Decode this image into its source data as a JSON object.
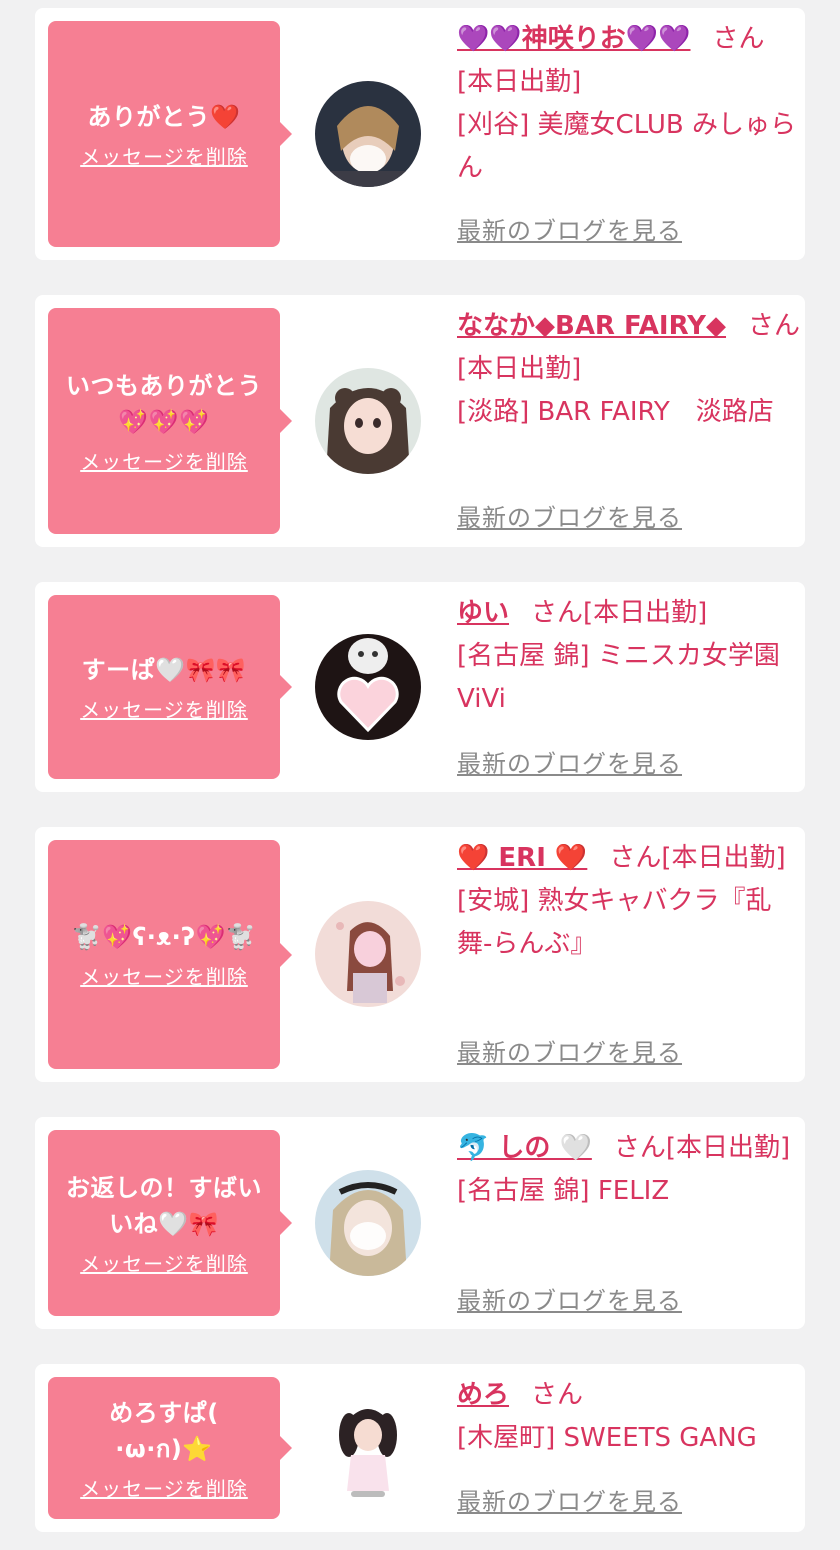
{
  "cards": [
    {
      "message": "ありがとう❤️",
      "delete_label": "メッセージを削除",
      "name": "💜💜神咲りお💜💜",
      "honorific": "さん",
      "status": "[本日出勤]",
      "shop": "[刈谷] 美魔女CLUB みしゅらん",
      "blog_label": "最新のブログを見る"
    },
    {
      "message": "いつもありがとう💖💖💖",
      "delete_label": "メッセージを削除",
      "name": "ななか◆BAR FAIRY◆",
      "honorific": "さん",
      "status": "[本日出勤]",
      "shop": "[淡路] BAR FAIRY　淡路店",
      "blog_label": "最新のブログを見る"
    },
    {
      "message": "すーぱ🤍🎀🎀",
      "delete_label": "メッセージを削除",
      "name": "ゆい",
      "honorific": "さん",
      "status": "[本日出勤]",
      "shop": "[名古屋 錦] ミニスカ女学園ViVi",
      "blog_label": "最新のブログを見る"
    },
    {
      "message": "🐩💖ʕ·ᴥ·ʔ💖🐩",
      "delete_label": "メッセージを削除",
      "name": "❤️ ERI ❤️",
      "honorific": "さん",
      "status": "[本日出勤]",
      "shop": "[安城] 熟女キャバクラ『乱舞-らんぶ』",
      "blog_label": "最新のブログを見る"
    },
    {
      "message": "お返しの！すばいいね🤍🎀",
      "delete_label": "メッセージを削除",
      "name": "🐬 しの 🤍",
      "honorific": "さん",
      "status": "[本日出勤]",
      "shop": "[名古屋 錦] FELIZ",
      "blog_label": "最新のブログを見る"
    },
    {
      "message": "めろすぱ( ·ω·ก)⭐",
      "delete_label": "メッセージを削除",
      "name": "めろ",
      "honorific": "さん",
      "status": "",
      "shop": "[木屋町] SWEETS GANG",
      "blog_label": "最新のブログを見る"
    }
  ],
  "colors": {
    "page_background": "#f1f1f2",
    "card_background": "#ffffff",
    "bubble": "#f67f93",
    "accent_text": "#d8345f",
    "muted_link": "#8a8a8a"
  }
}
